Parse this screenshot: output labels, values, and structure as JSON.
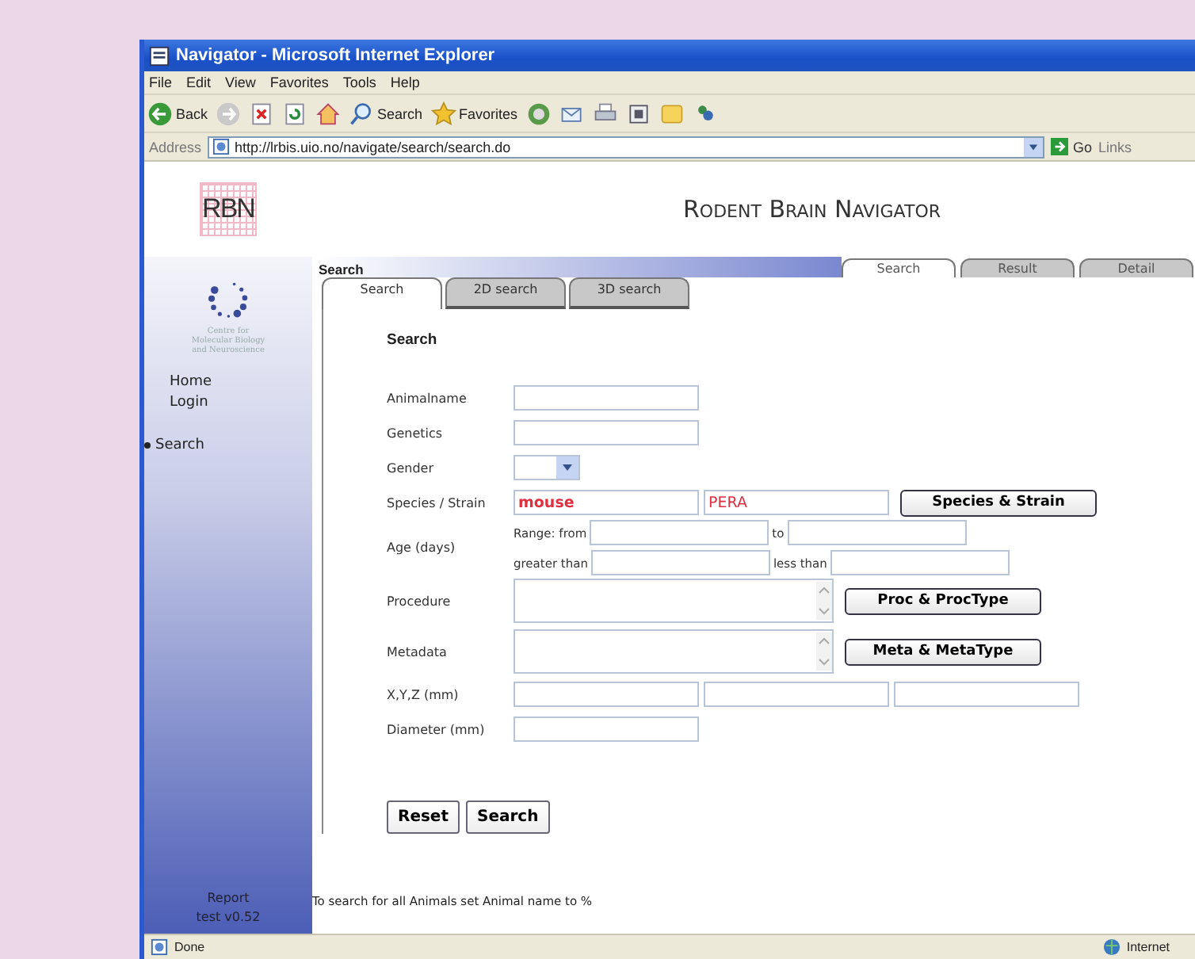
{
  "window": {
    "title": "Navigator - Microsoft Internet Explorer"
  },
  "menu": [
    {
      "label": "File"
    },
    {
      "label": "Edit"
    },
    {
      "label": "View"
    },
    {
      "label": "Favorites"
    },
    {
      "label": "Tools"
    },
    {
      "label": "Help"
    }
  ],
  "toolbar": {
    "back": "Back",
    "search": "Search",
    "favorites": "Favorites"
  },
  "address_bar": {
    "label": "Address",
    "url": "http://lrbis.uio.no/navigate/search/search.do",
    "go": "Go",
    "links": "Links"
  },
  "page": {
    "logo": "RBN",
    "title": "Rodent Brain Navigator",
    "org_name": [
      "Centre for",
      "Molecular Biology",
      "and Neuroscience"
    ],
    "nav": [
      {
        "label": "Home",
        "selected": false
      },
      {
        "label": "Login",
        "selected": false
      },
      {
        "label": "Search",
        "selected": true
      }
    ],
    "report": "Report",
    "version": "test v0.52",
    "section_label": "Search",
    "top_tabs": [
      {
        "label": "Search",
        "selected": true
      },
      {
        "label": "Result",
        "selected": false
      },
      {
        "label": "Detail",
        "selected": false
      }
    ],
    "sub_tabs": [
      {
        "label": "Search",
        "selected": true
      },
      {
        "label": "2D search",
        "selected": false
      },
      {
        "label": "3D search",
        "selected": false
      }
    ],
    "form_title": "Search",
    "rows": [
      {
        "kind": "text",
        "label": "Animalname"
      },
      {
        "kind": "text",
        "label": "Genetics"
      },
      {
        "kind": "select",
        "label": "Gender"
      },
      {
        "kind": "species",
        "label": "Species / Strain",
        "values": [
          "mouse",
          "PERA"
        ],
        "button": "Species & Strain"
      },
      {
        "kind": "age",
        "label": "Age (days)",
        "lines": [
          {
            "from": "Range: from",
            "to": "to"
          },
          {
            "from": "greater than",
            "to": "less than"
          }
        ]
      },
      {
        "kind": "textarea",
        "label": "Procedure",
        "button": "Proc & ProcType"
      },
      {
        "kind": "textarea",
        "label": "Metadata",
        "button": "Meta & MetaType"
      },
      {
        "kind": "triple",
        "label": "X,Y,Z (mm)"
      },
      {
        "kind": "text",
        "label": "Diameter (mm)"
      }
    ],
    "buttons": [
      {
        "label": "Reset"
      },
      {
        "label": "Search"
      }
    ],
    "hint": "To search for all Animals set Animal name to %"
  },
  "status_bar": {
    "text": "Done",
    "zone": "Internet"
  }
}
